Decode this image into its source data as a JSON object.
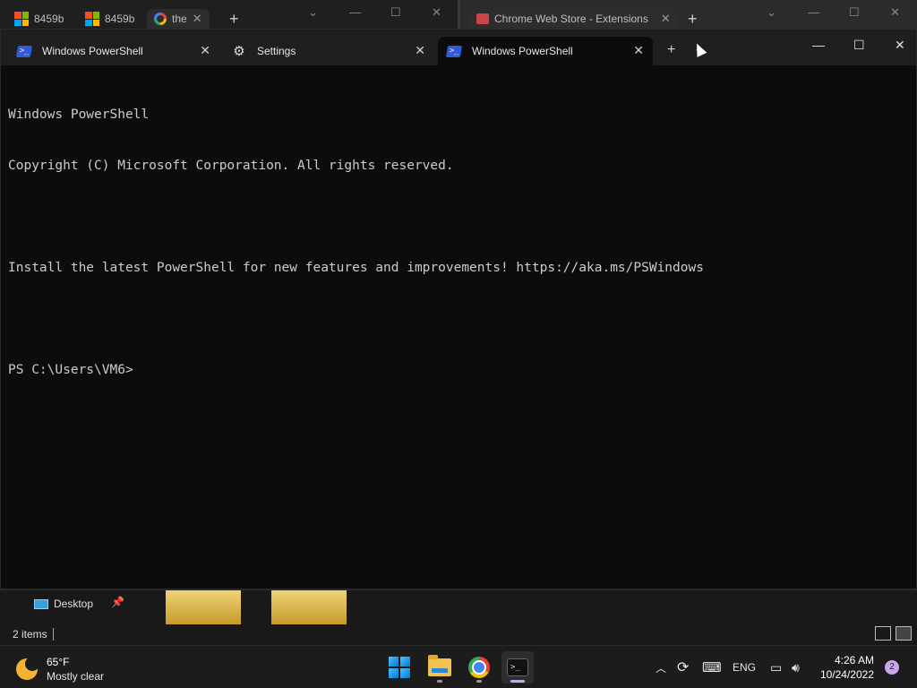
{
  "background_windows": {
    "left_tabs": [
      {
        "label": "8459b",
        "icon": "microsoft-icon"
      },
      {
        "label": "8459b",
        "icon": "microsoft-icon"
      },
      {
        "label": "the",
        "icon": "google-icon"
      }
    ],
    "right_tab": {
      "label": "Chrome Web Store - Extensions",
      "icon": "chrome-web-store-icon"
    }
  },
  "terminal": {
    "tabs": [
      {
        "label": "Windows PowerShell",
        "icon": "powershell-icon",
        "active": false
      },
      {
        "label": "Settings",
        "icon": "gear-icon",
        "active": false
      },
      {
        "label": "Windows PowerShell",
        "icon": "powershell-icon",
        "active": true
      }
    ],
    "console_lines": [
      "Windows PowerShell",
      "Copyright (C) Microsoft Corporation. All rights reserved.",
      "",
      "Install the latest PowerShell for new features and improvements! https://aka.ms/PSWindows",
      "",
      "PS C:\\Users\\VM6>"
    ]
  },
  "explorer": {
    "nav_item": "Desktop",
    "status": "2 items"
  },
  "taskbar": {
    "weather": {
      "temp": "65°F",
      "condition": "Mostly clear"
    },
    "tray": {
      "language": "ENG"
    },
    "clock": {
      "time": "4:26 AM",
      "date": "10/24/2022"
    },
    "notification_count": "2"
  },
  "colors": {
    "accent": "#c9a7f2",
    "terminal_bg": "#0c0c0c",
    "console_text": "#cccccc"
  }
}
